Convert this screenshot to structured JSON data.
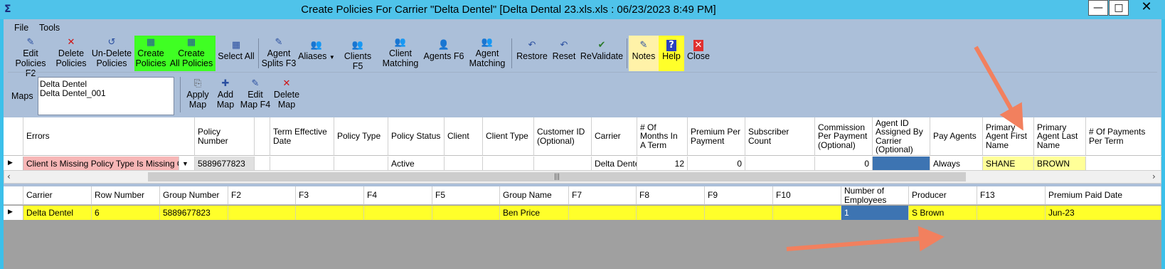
{
  "window": {
    "app_icon": "Σ",
    "title": "Create Policies For Carrier \"Delta Dentel\" [Delta Dental 23.xls.xls : 06/23/2023 8:49 PM]",
    "minimize": "—",
    "maximize": "□",
    "close": "✕"
  },
  "menu": {
    "file": "File",
    "tools": "Tools"
  },
  "toolbar": {
    "edit_policies": [
      "Edit",
      "Policies F2"
    ],
    "delete_policies": [
      "Delete",
      "Policies"
    ],
    "undelete_policies": [
      "Un-Delete",
      "Policies"
    ],
    "create_policies": [
      "Create",
      "Policies"
    ],
    "create_all_policies": [
      "Create",
      "All Policies"
    ],
    "select_all": "Select All",
    "agent_splits": [
      "Agent",
      "Splits F3"
    ],
    "aliases": "Aliases",
    "clients": "Clients F5",
    "client_matching": [
      "Client",
      "Matching"
    ],
    "agents": "Agents F6",
    "agent_matching": [
      "Agent",
      "Matching"
    ],
    "restore": "Restore",
    "reset": "Reset",
    "revalidate": "ReValidate",
    "notes": "Notes",
    "help": "Help",
    "close": "Close"
  },
  "maps": {
    "label": "Maps",
    "items": [
      "Delta Dentel",
      "Delta Dentel_001"
    ],
    "apply_map": [
      "Apply",
      "Map"
    ],
    "add_map": [
      "Add",
      "Map"
    ],
    "edit_map": [
      "Edit",
      "Map F4"
    ],
    "delete_map": [
      "Delete",
      "Map"
    ]
  },
  "policy_grid": {
    "columns": [
      "Errors",
      "Policy Number",
      "",
      "Term Effective Date",
      "Policy Type",
      "Policy Status",
      "Client",
      "Client Type",
      "Customer ID (Optional)",
      "Carrier",
      "# Of Months In A Term",
      "Premium Per Payment",
      "Subscriber Count",
      "Commission Per Payment (Optional)",
      "Agent ID Assigned By Carrier (Optional)",
      "Pay Agents",
      "Primary Agent First Name",
      "Primary Agent Last Name",
      "# Of Payments Per Term"
    ],
    "row": {
      "errors": "Client Is Missing  Policy Type Is Missing  Originat",
      "policy_number": "5889677823",
      "policy_status": "Active",
      "carrier": "Delta Dentel",
      "months": "12",
      "premium": "0",
      "commission": "0",
      "pay_agents": "Always",
      "first_name": "SHANE",
      "last_name": "BROWN"
    }
  },
  "source_grid": {
    "columns": [
      "Carrier",
      "Row Number",
      "Group Number",
      "F2",
      "F3",
      "F4",
      "F5",
      "Group Name",
      "F7",
      "F8",
      "F9",
      "F10",
      "Number of Employees",
      "Producer",
      "F13",
      "Premium Paid Date"
    ],
    "row": {
      "carrier": "Delta Dentel",
      "row_number": "6",
      "group_number": "5889677823",
      "group_name": "Ben Price",
      "employees": "1",
      "producer": "S Brown",
      "paid_date": "Jun-23"
    }
  },
  "colors": {
    "titlebar": "#4fc3ea",
    "window": "#abbfd9",
    "green_button": "#3fff23",
    "yellow": "#ffff2a",
    "error_bg": "#f7b6b6",
    "selected_blue": "#3d74b2",
    "arrow": "#f2805e"
  }
}
